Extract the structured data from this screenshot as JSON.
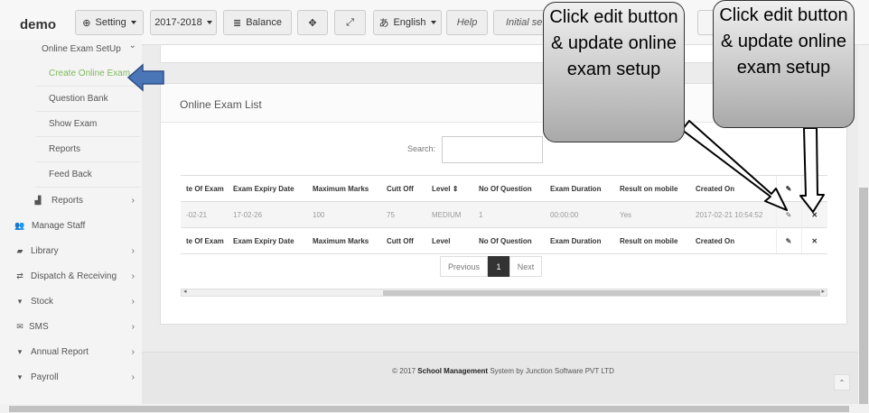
{
  "topbar": {
    "brand": "demo",
    "setting": "Setting",
    "year": "2017-2018",
    "balance": "Balance",
    "language": "English",
    "help": "Help",
    "initial_setup": "Initial setu"
  },
  "sidebar": {
    "items": [
      {
        "label": "Online Exam SetUp",
        "chevron": "⌄"
      },
      {
        "label": "Create Online Exam"
      },
      {
        "label": "Question Bank"
      },
      {
        "label": "Show Exam"
      },
      {
        "label": "Reports"
      },
      {
        "label": "Feed Back"
      },
      {
        "label": "Reports",
        "icon": "bar-chart-icon",
        "chevron": "›"
      },
      {
        "label": "Manage Staff",
        "icon": "users-icon"
      },
      {
        "label": "Library",
        "icon": "book-icon",
        "chevron": "›"
      },
      {
        "label": "Dispatch & Receiving",
        "icon": "exchange-icon",
        "chevron": "›"
      },
      {
        "label": "Stock",
        "icon": "cart-icon",
        "chevron": "›"
      },
      {
        "label": "SMS",
        "icon": "envelope-icon",
        "chevron": "›"
      },
      {
        "label": "Annual Report",
        "icon": "cart-icon",
        "chevron": "›"
      },
      {
        "label": "Payroll",
        "icon": "cart-icon",
        "chevron": "›"
      }
    ]
  },
  "panel": {
    "title": "Online Exam List",
    "search_label": "Search:"
  },
  "table": {
    "headers": [
      "te Of Exam",
      "Exam Expiry Date",
      "Maximum Marks",
      "Cutt Off",
      "Level",
      "No Of Question",
      "Exam Duration",
      "Result on mobile",
      "Created On"
    ],
    "rows": [
      [
        "-02-21",
        "17-02-26",
        "100",
        "75",
        "MEDIUM",
        "1",
        "00:00:00",
        "Yes",
        "2017-02-21 10:54:52"
      ]
    ],
    "footer": [
      "te Of Exam",
      "Exam Expiry Date",
      "Maximum Marks",
      "Cutt Off",
      "Level",
      "No Of Question",
      "Exam Duration",
      "Result on mobile",
      "Created On"
    ]
  },
  "pagination": {
    "previous": "Previous",
    "current": "1",
    "next": "Next"
  },
  "footer": {
    "prefix": "© 2017",
    "bold": "School Management",
    "suffix": "System by Junction Software PVT LTD"
  },
  "callouts": [
    "Click edit button & update online exam setup",
    "Click edit button & update online exam setup"
  ],
  "colors": {
    "active_link": "#7dba5a",
    "pointer_arrow": "#4a76b8"
  }
}
